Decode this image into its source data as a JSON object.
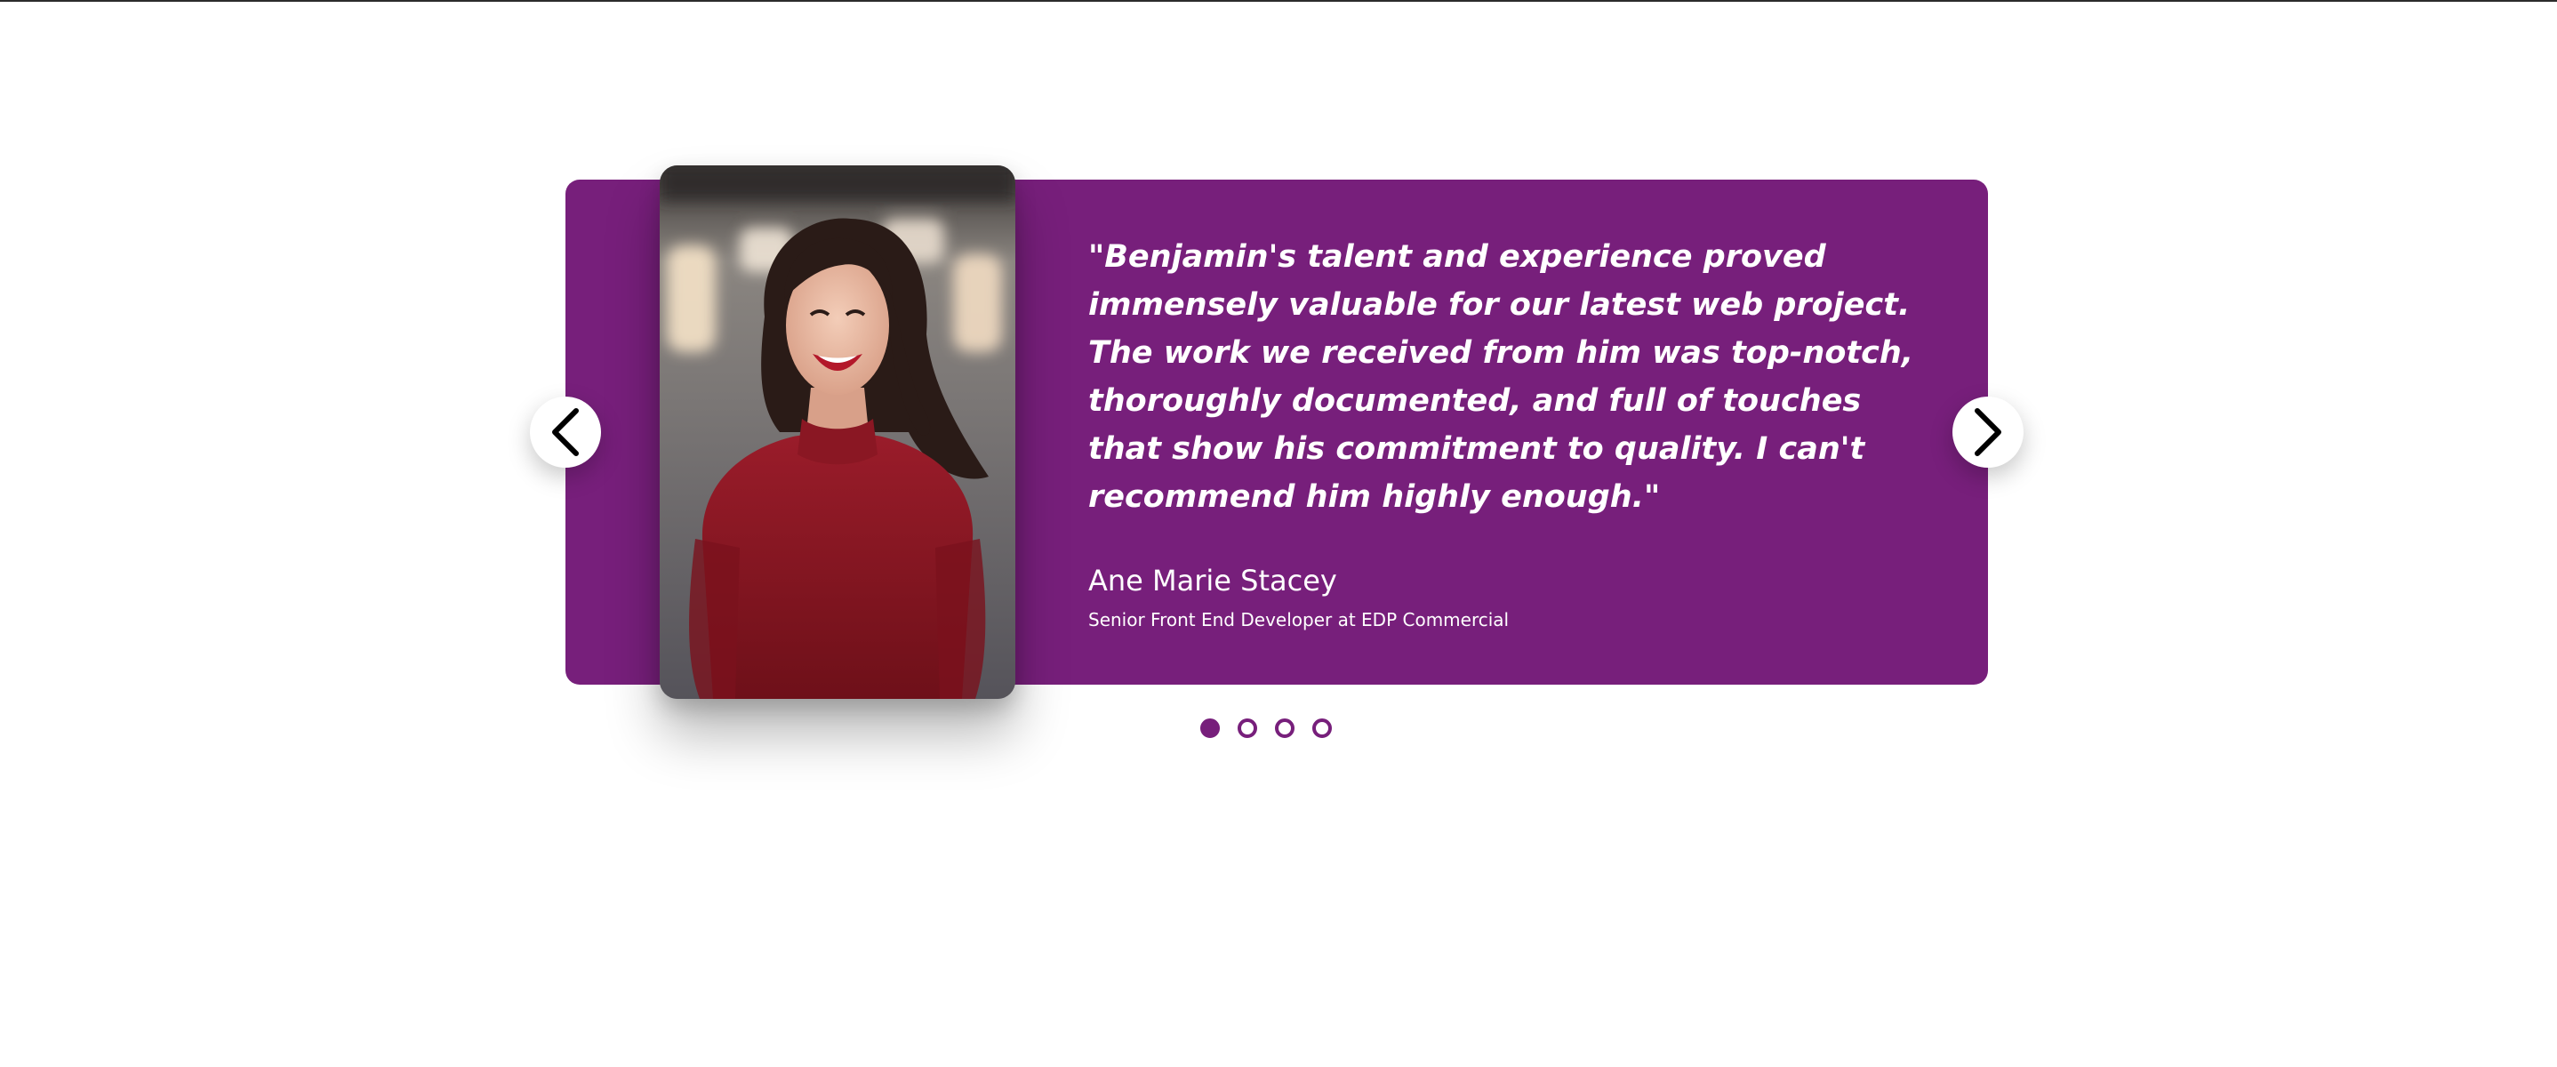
{
  "theme": {
    "accent": "#771f7b",
    "text_on_accent": "#ffffff",
    "page_background": "#ffffff"
  },
  "carousel": {
    "prev_icon": "chevron-left-icon",
    "next_icon": "chevron-right-icon",
    "slide_count": 4,
    "active_index": 0,
    "testimonial": {
      "photo": "portrait-photo",
      "quote": "\"Benjamin's talent and experience proved immensely valuable for our latest web project. The work we received from him was top-notch, thoroughly documented, and full of touches that show his commitment to quality. I can't recommend him highly enough.\"",
      "author_name": "Ane Marie Stacey",
      "author_role": "Senior Front End Developer at EDP Commercial"
    }
  }
}
